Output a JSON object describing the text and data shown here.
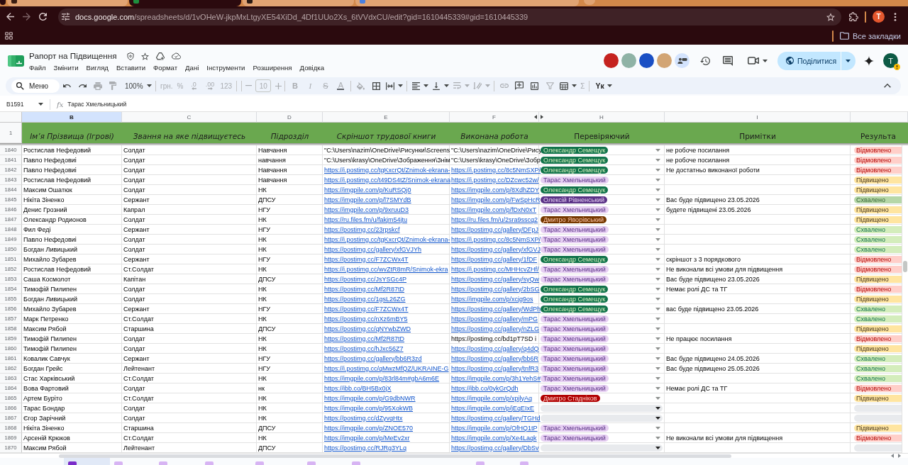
{
  "browser": {
    "tabs": [
      {
        "selected": false,
        "color": "#3b1d12"
      },
      {
        "selected": true,
        "color": "#1e8e3e"
      },
      {
        "selected": false,
        "color": "#2b1a14"
      },
      {
        "selected": false,
        "color": "#4a7fe0"
      }
    ],
    "back": {
      "disabled": false
    },
    "forward": {
      "disabled": true
    },
    "url": {
      "domain": "docs.google.com",
      "path": "/spreadsheets/d/1vOHeW-jkpMxLtgyXE54XiDd_4Df1UUo2Xs_6tVVdxCU/edit?gid=1610445339#gid=1610445339"
    },
    "bookmarked": false,
    "profile_initial": "T",
    "bookmarks_label": "Все закладки"
  },
  "document": {
    "title": "Рапорт на Підвищення",
    "starred": false
  },
  "menu": [
    "Файл",
    "Змінити",
    "Вигляд",
    "Вставити",
    "Формат",
    "Дані",
    "Інструменти",
    "Розширення",
    "Довідка"
  ],
  "collaborators": [
    {
      "color": "#c5221f"
    },
    {
      "color": "#8fb3a6"
    },
    {
      "color": "#1a4fc4"
    },
    {
      "color": "#d2a574"
    }
  ],
  "share": {
    "label": "Поділитися"
  },
  "account": {
    "initial": "T",
    "warning": true
  },
  "toolbar": {
    "search": {
      "placeholder": "Меню"
    },
    "items": [
      {
        "kind": "undo",
        "disabled": false
      },
      {
        "kind": "redo",
        "disabled": false
      },
      {
        "kind": "print",
        "disabled": true
      },
      {
        "kind": "paintformat",
        "disabled": true
      },
      {
        "kind": "text",
        "label": "100%",
        "dropdown": true,
        "disabled": false
      },
      {
        "kind": "separator"
      },
      {
        "kind": "text",
        "label": "грн.",
        "disabled": true
      },
      {
        "kind": "text",
        "label": "%",
        "disabled": true
      },
      {
        "kind": "decrease",
        "label": ".0",
        "disabled": true
      },
      {
        "kind": "increase",
        "label": ".00",
        "disabled": true
      },
      {
        "kind": "text",
        "label": "123",
        "disabled": true
      },
      {
        "kind": "separator"
      },
      {
        "kind": "separator"
      },
      {
        "kind": "minus",
        "disabled": true
      },
      {
        "kind": "field",
        "value": "10",
        "disabled": true
      },
      {
        "kind": "plus",
        "disabled": true
      },
      {
        "kind": "separator"
      },
      {
        "kind": "bold",
        "label": "B",
        "disabled": true
      },
      {
        "kind": "italic",
        "label": "I",
        "disabled": true
      },
      {
        "kind": "strike",
        "label": "S",
        "disabled": true
      },
      {
        "kind": "textcolor",
        "label": "A",
        "disabled": true
      },
      {
        "kind": "separator"
      },
      {
        "kind": "fill",
        "disabled": true
      },
      {
        "kind": "borders",
        "disabled": false
      },
      {
        "kind": "merge",
        "dropdown": true,
        "disabled": false
      },
      {
        "kind": "separator"
      },
      {
        "kind": "align",
        "dropdown": true,
        "disabled": false
      },
      {
        "kind": "valign",
        "dropdown": true,
        "disabled": false
      },
      {
        "kind": "wrap",
        "dropdown": true,
        "disabled": true
      },
      {
        "kind": "rotate",
        "dropdown": true,
        "disabled": true
      },
      {
        "kind": "separator"
      },
      {
        "kind": "link",
        "disabled": true
      },
      {
        "kind": "comment",
        "disabled": false
      },
      {
        "kind": "chart",
        "disabled": false
      },
      {
        "kind": "filter",
        "disabled": true
      },
      {
        "kind": "functions",
        "dropdown": true,
        "disabled": false
      },
      {
        "kind": "text",
        "label": "Σ",
        "disabled": true
      },
      {
        "kind": "separator"
      },
      {
        "kind": "input",
        "label": "Yк",
        "dropdown": true,
        "disabled": false
      }
    ]
  },
  "formula_bar": {
    "cell": "B1591",
    "fx": "fx",
    "value": "Тарас Хмельницький"
  },
  "columns": [
    {
      "letter": "B",
      "selected": true
    },
    {
      "letter": "C",
      "selected": false
    },
    {
      "letter": "D",
      "selected": false
    },
    {
      "letter": "E",
      "selected": false
    },
    {
      "letter": "F",
      "selected": false,
      "hidden_next": true
    },
    {
      "letter": "H",
      "selected": false
    },
    {
      "letter": "I",
      "selected": false
    },
    {
      "selected": false
    }
  ],
  "header_row": {
    "number": "1",
    "cells": [
      {
        "text": "Ім’я Прізвища (Ігрові)",
        "italic": true
      },
      {
        "text": "Звання на яке підвищуєтесь",
        "italic": true
      },
      {
        "text": "Підрозділ",
        "italic": true
      },
      {
        "text": "Скріншот трудової книги",
        "italic": true
      },
      {
        "text": "Виконана робота",
        "italic": true
      },
      {
        "text": "Перевіряючий",
        "italic": false
      },
      {
        "text": "Примітки",
        "italic": false
      },
      {
        "text": "Результа",
        "italic": false
      }
    ]
  },
  "rows": [
    {
      "number": "1840",
      "name": "Ростислав Нефедовий",
      "rank": "Солдат",
      "unit": "Навчання",
      "screenshot": {
        "text": "\"C:\\Users\\nazim\\OneDrive\\Рисунки\\Screens",
        "link": false
      },
      "work": {
        "text": "\"C:\\Users\\nazim\\OneDrive\\Рису",
        "link": false
      },
      "reviewer": {
        "name": "Олександр Семещук",
        "color": "#11734b"
      },
      "note": "не робоче посилання",
      "result": {
        "text": "Відмовлено",
        "color": "#ffcfc9"
      }
    },
    {
      "number": "1841",
      "name": "Павло Нефедовиі",
      "rank": "Солдат",
      "unit": "навчання",
      "screenshot": {
        "text": "\"C:\\Users\\krasy\\OneDrive\\Зображення\\Знім",
        "link": false
      },
      "work": {
        "text": "\"C:\\Users\\krasy\\OneDrive\\Зобр",
        "link": false
      },
      "reviewer": {
        "name": "Олександр Семещук",
        "color": "#11734b"
      },
      "note": "не робоче посилання",
      "result": {
        "text": "Відмовлено",
        "color": "#ffcfc9"
      }
    },
    {
      "number": "1842",
      "name": "Павло Нефедовиі",
      "rank": "Солдат",
      "unit": "Навчання",
      "screenshot": {
        "text": "https://i.postimg.cc/tgKxcrQt/Znimok-ekrana-",
        "link": true
      },
      "work": {
        "text": "https://i.postimg.cc/8c5NmSXP/",
        "link": true
      },
      "reviewer": {
        "name": "Олександр Семещук",
        "color": "#11734b"
      },
      "note": "Не достатньо виконаної роботи",
      "result": {
        "text": "Відмовлено",
        "color": "#ffcfc9"
      }
    },
    {
      "number": "1843",
      "name": "Ростислав Нефедовий",
      "rank": "Солдат",
      "unit": "Навчання",
      "screenshot": {
        "text": "https://i.postimg.cc/t49DS4tZ/Snimok-ekrana",
        "link": true
      },
      "work": {
        "text": "https://i.postimg.cc/DZcwc52w/",
        "link": true
      },
      "reviewer": {
        "name": "Тарас Хмельницький",
        "color": "#e6cff2"
      },
      "result": {
        "text": "Підвищено",
        "color": "#ffe5a0"
      }
    },
    {
      "number": "1844",
      "name": "Максим Ошатюк",
      "rank": "Солдат",
      "unit": "НК",
      "screenshot": {
        "text": "https://imgpile.com/p/KuRSQj0",
        "link": true
      },
      "work": {
        "text": "https://imgpile.com/p/8XdhZDY",
        "link": true
      },
      "reviewer": {
        "name": "Олександр Семещук",
        "color": "#11734b"
      },
      "result": {
        "text": "Підвищено",
        "color": "#ffe5a0"
      }
    },
    {
      "number": "1845",
      "name": "Нікіта Зіненко",
      "rank": "Сержант",
      "unit": "ДПСУ",
      "screenshot": {
        "text": "https://imgpile.com/p/l7SMYdB",
        "link": true
      },
      "work": {
        "text": "https://imgpile.com/p/FwSpHcR",
        "link": true
      },
      "reviewer": {
        "name": "Олексій Рівненський",
        "color": "#5a3286"
      },
      "note": "Вас буде підвищено 23.05.2026",
      "result": {
        "text": "Схвалено",
        "color": "#b6d7a8"
      }
    },
    {
      "number": "1846",
      "name": "Денис Грозний",
      "rank": "Капрал",
      "unit": "НГУ",
      "screenshot": {
        "text": "https://imgpile.com/p/9xruuD3",
        "link": true
      },
      "work": {
        "text": "https://imgpile.com/p/fDxN0xT",
        "link": true
      },
      "reviewer": {
        "name": "Тарас Хмельницький",
        "color": "#e6cff2"
      },
      "note": "будете підвищені 23.05.2026",
      "result": {
        "text": "Підвищено",
        "color": "#ffe5a0"
      }
    },
    {
      "number": "1847",
      "name": "Олександр Родионов",
      "rank": "Солдат",
      "unit": "НК",
      "screenshot": {
        "text": "https://ru.files.fm/u/fakjm54jtu",
        "link": true
      },
      "work": {
        "text": "https://ru.files.fm/u/2sra9sscq2",
        "link": true
      },
      "reviewer": {
        "name": "Дмитро Яворівський",
        "color": "#753800"
      },
      "result": {
        "text": "Підвищено",
        "color": "#ffe5a0"
      }
    },
    {
      "number": "1848",
      "name": "Фил Феді",
      "rank": "Сержант",
      "unit": "НГУ",
      "screenshot": {
        "text": "https://postimg.cc/23rpskcf",
        "link": true
      },
      "work": {
        "text": "https://postimg.cc/gallery/DFpJ",
        "link": true
      },
      "reviewer": {
        "name": "Тарас Хмельницький",
        "color": "#e6cff2"
      },
      "result": {
        "text": "Схвалено",
        "color": "#d4edbc"
      }
    },
    {
      "number": "1849",
      "name": "Павло Нефедовиі",
      "rank": "Солдат",
      "unit": "НК",
      "screenshot": {
        "text": "https://i.postimg.cc/tgKxcrQt/Znimok-ekrana-",
        "link": true
      },
      "work": {
        "text": "https://i.postimg.cc/8c5NmSXP/",
        "link": true
      },
      "reviewer": {
        "name": "Тарас Хмельницький",
        "color": "#e6cff2"
      },
      "result": {
        "text": "Схвалено",
        "color": "#d4edbc"
      }
    },
    {
      "number": "1850",
      "name": "Богдан Ливицький",
      "rank": "Солдат",
      "unit": "НК",
      "screenshot": {
        "text": "https://postimg.cc/gallery/xfGVJYh",
        "link": true
      },
      "work": {
        "text": "https://postimg.cc/gallery/xfGVJ",
        "link": true
      },
      "reviewer": {
        "name": "Тарас Хмельницький",
        "color": "#e6cff2"
      },
      "result": {
        "text": "Схвалено",
        "color": "#d4edbc"
      }
    },
    {
      "number": "1851",
      "name": "Михайло Зубарев",
      "rank": "Сержант",
      "unit": "НГУ",
      "screenshot": {
        "text": "https://postimg.cc/F7ZCWx4T",
        "link": true
      },
      "work": {
        "text": "https://postimg.cc/gallery/1fDF",
        "link": true
      },
      "reviewer": {
        "name": "Олександр Семещук",
        "color": "#11734b"
      },
      "note": "скріншот з 3 порядкового",
      "result": {
        "text": "Відмовлено",
        "color": "#ffcfc9"
      }
    },
    {
      "number": "1852",
      "name": "Ростислав Нефедовий",
      "rank": "Ст.Солдат",
      "unit": "НК",
      "screenshot": {
        "text": "https://i.postimg.cc/wvZtR8mR/Snimok-ekra",
        "link": true
      },
      "work": {
        "text": "https://i.postimg.cc/MHHcvZHf/",
        "link": true
      },
      "reviewer": {
        "name": "Тарас Хмельницький",
        "color": "#e6cff2"
      },
      "note": "Не виконали всі умови для підвищення",
      "result": {
        "text": "Відмовлено",
        "color": "#ffcfc9"
      }
    },
    {
      "number": "1853",
      "name": "Саша Космолот",
      "rank": "Капітан",
      "unit": "ДПСУ",
      "screenshot": {
        "text": "https://postimg.cc/JsYSGc4P",
        "link": true
      },
      "work": {
        "text": "https://postimg.cc/gallery/syQw",
        "link": true
      },
      "reviewer": {
        "name": "Тарас Хмельницький",
        "color": "#e6cff2"
      },
      "note": "Вас буде підвищено 23.05.2026",
      "result": {
        "text": "Підвищено",
        "color": "#ffe5a0"
      }
    },
    {
      "number": "1854",
      "name": "Тимофій Пилипен",
      "rank": "Солдат",
      "unit": "НК",
      "screenshot": {
        "text": "https://postimg.cc/Mf2R87tD",
        "link": true
      },
      "work": {
        "text": "https://postimg.cc/gallery/2bSG",
        "link": true
      },
      "reviewer": {
        "name": "Олександр Семещук",
        "color": "#11734b"
      },
      "note": "Немає ролі ДС та ТГ",
      "result": {
        "text": "Відмовлено",
        "color": "#ffcfc9"
      }
    },
    {
      "number": "1855",
      "name": "Богдан Ливицький",
      "rank": "Солдат",
      "unit": "НК",
      "screenshot": {
        "text": "https://postimg.cc/1gsL26ZG",
        "link": true
      },
      "work": {
        "text": "https://imgpile.com/p/xcjg9os",
        "link": true
      },
      "reviewer": {
        "name": "Олександр Семещук",
        "color": "#11734b"
      },
      "result": {
        "text": "Підвищено",
        "color": "#ffe5a0"
      }
    },
    {
      "number": "1856",
      "name": "Михайло Зубарев",
      "rank": "Сержант",
      "unit": "НГУ",
      "screenshot": {
        "text": "https://postimg.cc/F7ZCWx4T",
        "link": true
      },
      "work": {
        "text": "https://postimg.cc/gallery/WdPh",
        "link": true
      },
      "reviewer": {
        "name": "Олександр Семещук",
        "color": "#11734b"
      },
      "note": "вас буде підвищено 23.05.2026",
      "result": {
        "text": "Схвалено",
        "color": "#d4edbc"
      }
    },
    {
      "number": "1857",
      "name": "Марк Петренко",
      "rank": "Ст.Солдат",
      "unit": "НК",
      "screenshot": {
        "text": "https://postimg.cc/nXz6mBY5",
        "link": true
      },
      "work": {
        "text": "https://postimg.cc/gallery/mPG",
        "link": true
      },
      "reviewer": {
        "name": "Тарас Хмельницький",
        "color": "#e6cff2"
      },
      "result": {
        "text": "Схвалено",
        "color": "#d4edbc"
      }
    },
    {
      "number": "1858",
      "name": "Максим Рябой",
      "rank": "Старшина",
      "unit": "ДПСУ",
      "screenshot": {
        "text": "https://postimg.cc/qNYwbZWD",
        "link": true
      },
      "work": {
        "text": "https://postimg.cc/gallery/nZLG",
        "link": true
      },
      "reviewer": {
        "name": "Тарас Хмельницький",
        "color": "#e6cff2"
      },
      "result": {
        "text": "Підвищено",
        "color": "#ffe5a0"
      }
    },
    {
      "number": "1859",
      "name": "Тимофій Пилипен",
      "rank": "Солдат",
      "unit": "НК",
      "screenshot": {
        "text": "https://postimg.cc/Mf2R87tD",
        "link": true
      },
      "work": {
        "text": "https://postimg.cc/bd1pT7SD і",
        "link": false
      },
      "reviewer": {
        "name": "Тарас Хмельницький",
        "color": "#e6cff2"
      },
      "note": "Не працює посилання",
      "result": {
        "text": "Відмовлено",
        "color": "#ffcfc9"
      }
    },
    {
      "number": "1860",
      "name": "Тимофій Пилипен",
      "rank": "Солдат",
      "unit": "НК",
      "screenshot": {
        "text": "https://postimg.cc/hJxc56Z7",
        "link": true
      },
      "work": {
        "text": "https://postimg.cc/gallery/q4dQ",
        "link": true
      },
      "reviewer": {
        "name": "Тарас Хмельницький",
        "color": "#e6cff2"
      },
      "result": {
        "text": "Підвищено",
        "color": "#ffe5a0"
      }
    },
    {
      "number": "1861",
      "name": "Ковалик Савчук",
      "rank": "Сержант",
      "unit": "НГУ",
      "screenshot": {
        "text": "https://postimg.cc/gallery/bb6R3zd",
        "link": true
      },
      "work": {
        "text": "https://postimg.cc/gallery/bb6R",
        "link": true
      },
      "reviewer": {
        "name": "Тарас Хмельницький",
        "color": "#e6cff2"
      },
      "note": "Вас буде підвищено 24.05.2026",
      "result": {
        "text": "Схвалено",
        "color": "#d4edbc"
      }
    },
    {
      "number": "1862",
      "name": "Богдан Грейс",
      "rank": "Лейтенант",
      "unit": "НГУ",
      "screenshot": {
        "text": "https://i.postimg.cc/qMwzMfQZ/UKRAINE-G",
        "link": true
      },
      "work": {
        "text": "https://postimg.cc/gallery/tnfR3",
        "link": true
      },
      "reviewer": {
        "name": "Тарас Хмельницький",
        "color": "#e6cff2"
      },
      "note": "Вас буде підвищено 25.05.2026",
      "result": {
        "text": "Схвалено",
        "color": "#d4edbc"
      }
    },
    {
      "number": "1863",
      "name": "Стас Харківський",
      "rank": "Ст.Солдат",
      "unit": "НК",
      "screenshot": {
        "text": "https://imgpile.com/p/83rl84m#gbA6m6E",
        "link": true
      },
      "work": {
        "text": "https://imgpile.com/p/3h1YehS#",
        "link": true
      },
      "reviewer": {
        "name": "Тарас Хмельницький",
        "color": "#e6cff2"
      },
      "result": {
        "text": "Схвалено",
        "color": "#d4edbc"
      }
    },
    {
      "number": "1864",
      "name": "Вова Фартовий",
      "rank": "Солдат",
      "unit": "нк",
      "screenshot": {
        "text": "https://ibb.co/BH5Bx0jX",
        "link": true
      },
      "work": {
        "text": "https://ibb.co/0ykGrQdh",
        "link": true
      },
      "reviewer": {
        "name": "Тарас Хмельницький",
        "color": "#e6cff2"
      },
      "note": "Немає ролі ДС та ТГ",
      "result": {
        "text": "Відмовлено",
        "color": "#ffcfc9"
      }
    },
    {
      "number": "1865",
      "name": "Артем Буріто",
      "rank": "Ст.Солдат",
      "unit": "НК",
      "screenshot": {
        "text": "https://imgpile.com/p/G9dbNWR",
        "link": true
      },
      "work": {
        "text": "https://imgpile.com/p/xpjlyAq",
        "link": true
      },
      "reviewer": {
        "name": "Дмитро Стадніков",
        "color": "#b10202"
      },
      "result": {
        "text": "Підвищено",
        "color": "#ffe5a0"
      }
    },
    {
      "number": "1866",
      "name": "Тарас Бондар",
      "rank": "Солдат",
      "unit": "НК",
      "screenshot": {
        "text": "https://imgpile.com/p/95XokWB",
        "link": true
      },
      "work": {
        "text": "https://imgpile.com/p/jEqEIxE",
        "link": true
      },
      "result": {
        "color": "#e8eaed"
      }
    },
    {
      "number": "1867",
      "name": "Єгор Зарічний",
      "rank": "Солдат",
      "unit": "НК",
      "screenshot": {
        "text": "https://postimg.cc/dZyvqHtx",
        "link": true
      },
      "work": {
        "text": "https://postimg.cc/gallery/TGHd",
        "link": true
      },
      "result": {
        "color": "#e8eaed"
      }
    },
    {
      "number": "1868",
      "name": "Нікіта Зіненко",
      "rank": "Старшина",
      "unit": "ДПСУ",
      "screenshot": {
        "text": "https://imgpile.com/p/ZNOE570",
        "link": true
      },
      "work": {
        "text": "https://imgpile.com/p/OfHQ1tP",
        "link": true
      },
      "reviewer": {
        "name": "Тарас Хмельницький",
        "color": "#e6cff2"
      },
      "result": {
        "text": "Підвищено",
        "color": "#ffe5a0"
      }
    },
    {
      "number": "1869",
      "name": "Арсеній Крюков",
      "rank": "Ст.Солдат",
      "unit": "НК",
      "screenshot": {
        "text": "https://imgpile.com/p/MeEv2xr",
        "link": true
      },
      "work": {
        "text": "https://imgpile.com/p/Xe4Laqk",
        "link": true
      },
      "reviewer": {
        "name": "Тарас Хмельницький",
        "color": "#e6cff2"
      },
      "note": "Не виконали всі умови для підвищення",
      "result": {
        "text": "Відмовлено",
        "color": "#ffcfc9"
      }
    },
    {
      "number": "1870",
      "name": "Максим Рябой",
      "rank": "Лейтенант",
      "unit": "ДПСУ",
      "screenshot": {
        "text": "https://postimg.cc/RJRg3YLq",
        "link": true
      },
      "work": {
        "text": "https://postimg.cc/gallery/DbSv",
        "link": true
      },
      "result": {
        "color": "#e8eaed"
      }
    }
  ],
  "sheet_tabs": [
    {
      "selected": true
    },
    {
      "selected": false
    },
    {
      "selected": false
    },
    {
      "selected": false
    },
    {
      "selected": false
    },
    {
      "selected": false
    },
    {
      "selected": false
    },
    {
      "selected": false
    },
    {
      "selected": false
    }
  ]
}
